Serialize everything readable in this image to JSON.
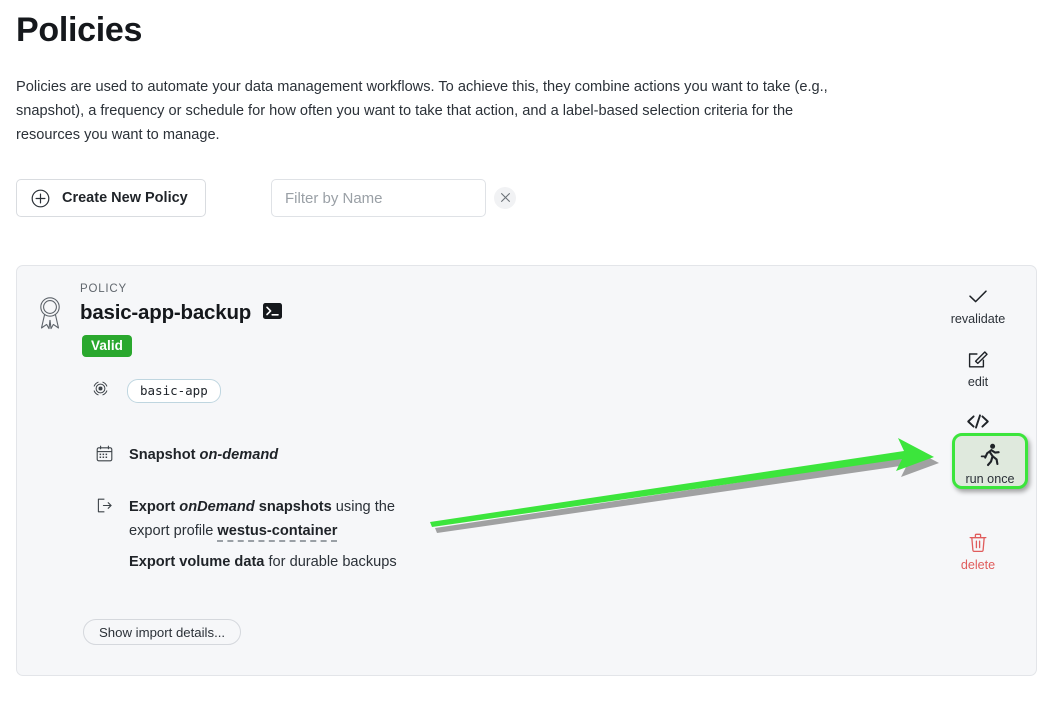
{
  "header": {
    "title": "Policies",
    "description": "Policies are used to automate your data management workflows. To achieve this, they combine actions you want to take (e.g., snapshot), a frequency or schedule for how often you want to take that action, and a label-based selection criteria for the resources you want to manage."
  },
  "toolbar": {
    "create_label": "Create New Policy",
    "filter_placeholder": "Filter by Name",
    "filter_value": "",
    "clear_icon": "close-icon",
    "plus_icon": "plus-circle-icon"
  },
  "policy": {
    "eyebrow": "POLICY",
    "name": "basic-app-backup",
    "terminal_icon": "terminal-icon",
    "ribbon_icon": "award-ribbon-icon",
    "status": "Valid",
    "status_color": "#2aa82e",
    "label_icon": "target-icon",
    "label_chip": "basic-app",
    "details": [
      {
        "icon": "calendar-icon",
        "lines": [
          [
            {
              "t": "Snapshot ",
              "s": "b"
            },
            {
              "t": "on-demand",
              "s": "bi"
            }
          ]
        ]
      },
      {
        "icon": "export-icon",
        "lines": [
          [
            {
              "t": "Export ",
              "s": "b"
            },
            {
              "t": "onDemand",
              "s": "bi"
            },
            {
              "t": " snapshots",
              "s": "b"
            },
            {
              "t": " using the",
              "s": ""
            }
          ],
          [
            {
              "t": "export profile ",
              "s": ""
            },
            {
              "t": "westus-container",
              "s": "dashed"
            }
          ],
          [
            {
              "t": "Export volume data",
              "s": "b"
            },
            {
              "t": " for durable backups",
              "s": ""
            }
          ]
        ]
      }
    ],
    "show_import_label": "Show import details...",
    "actions": [
      {
        "name": "revalidate",
        "label": "revalidate",
        "icon": "check-icon"
      },
      {
        "name": "edit",
        "label": "edit",
        "icon": "pencil-square-icon"
      },
      {
        "name": "yaml",
        "label": "yaml",
        "icon": "code-brackets-icon"
      },
      {
        "name": "run-once",
        "label": "run once",
        "icon": "runner-icon"
      },
      {
        "name": "delete",
        "label": "delete",
        "icon": "trash-icon"
      }
    ]
  },
  "annotation": {
    "type": "arrow",
    "color": "#3ce53c",
    "points_to": "run once",
    "highlight_color": "#3ce53c"
  }
}
